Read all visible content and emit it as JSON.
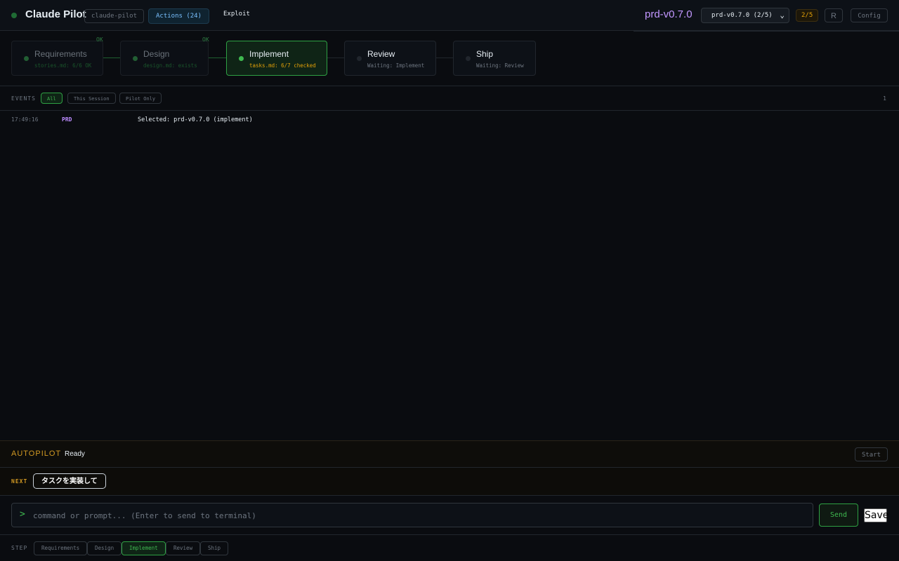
{
  "header": {
    "title": "Claude Pilot",
    "repo": "claude-pilot",
    "actions_label": "Actions (24)",
    "exploit_label": "Exploit",
    "prd_title": "prd-v0.7.0",
    "prd_select_value": "prd-v0.7.0 (2/5)",
    "progress_badge": "2/5",
    "r_button": "R",
    "config_button": "Config"
  },
  "pipeline": {
    "steps": [
      {
        "name": "Requirements",
        "status": "stories.md: 6/6 OK",
        "state": "done",
        "ok": "OK"
      },
      {
        "name": "Design",
        "status": "design.md: exists",
        "state": "done",
        "ok": "OK"
      },
      {
        "name": "Implement",
        "status": "tasks.md: 6/7 checked",
        "state": "active",
        "ok": ""
      },
      {
        "name": "Review",
        "status": "Waiting: Implement",
        "state": "pending",
        "ok": ""
      },
      {
        "name": "Ship",
        "status": "Waiting: Review",
        "state": "pending",
        "ok": ""
      }
    ]
  },
  "events": {
    "label": "EVENTS",
    "filters": [
      "All",
      "This Session",
      "Pilot Only"
    ],
    "active_filter": "All",
    "count": "1",
    "rows": [
      {
        "time": "17:49:16",
        "tag": "PRD",
        "message": "Selected: prd-v0.7.0 (implement)"
      }
    ]
  },
  "autopilot": {
    "label": "AUTOPILOT",
    "status": "Ready",
    "start_label": "Start"
  },
  "next": {
    "label": "NEXT",
    "task": "タスクを実装して"
  },
  "command": {
    "prompt_glyph": ">",
    "placeholder": "command or prompt... (Enter to send to terminal)",
    "value": "",
    "send_label": "Send",
    "save_label": "Save"
  },
  "step_bar": {
    "label": "STEP",
    "steps": [
      "Requirements",
      "Design",
      "Implement",
      "Review",
      "Ship"
    ],
    "active": "Implement"
  },
  "colors": {
    "accent_green": "#3fb950",
    "accent_purple": "#bc8cff",
    "accent_amber": "#d29922",
    "background": "#0a0c10"
  }
}
